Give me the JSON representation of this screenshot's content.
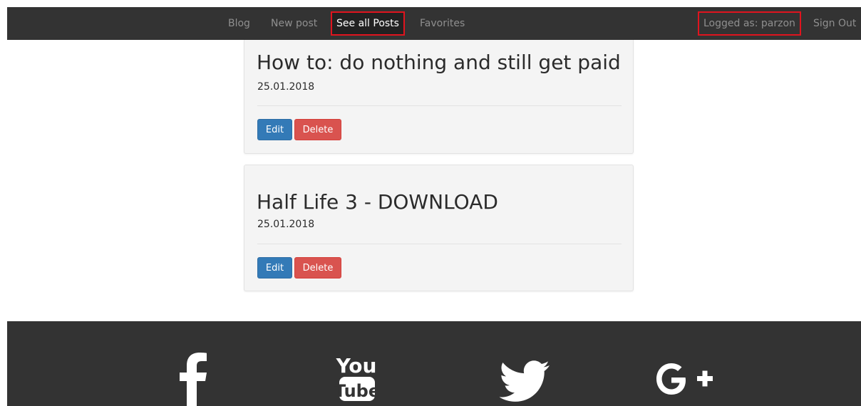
{
  "navbar": {
    "items": [
      {
        "label": "Blog"
      },
      {
        "label": "New post"
      },
      {
        "label": "See all Posts"
      },
      {
        "label": "Favorites"
      }
    ],
    "user_label": "Logged as: parzon",
    "signout_label": "Sign Out"
  },
  "posts": [
    {
      "title": "How to: do nothing and still get paid",
      "date": "25.01.2018",
      "edit_label": "Edit",
      "delete_label": "Delete"
    },
    {
      "title": "Half Life 3 - DOWNLOAD",
      "date": "25.01.2018",
      "edit_label": "Edit",
      "delete_label": "Delete"
    }
  ],
  "footer": {
    "social": [
      "facebook-icon",
      "youtube-icon",
      "twitter-icon",
      "google-plus-icon"
    ],
    "youtube_text_top": "You",
    "youtube_text_bottom": "Tube"
  },
  "colors": {
    "navbar_bg": "#333333",
    "highlight_border": "#e0141e",
    "edit_button": "#337ab7",
    "delete_button": "#d9534f",
    "card_bg": "#f4f4f4"
  }
}
